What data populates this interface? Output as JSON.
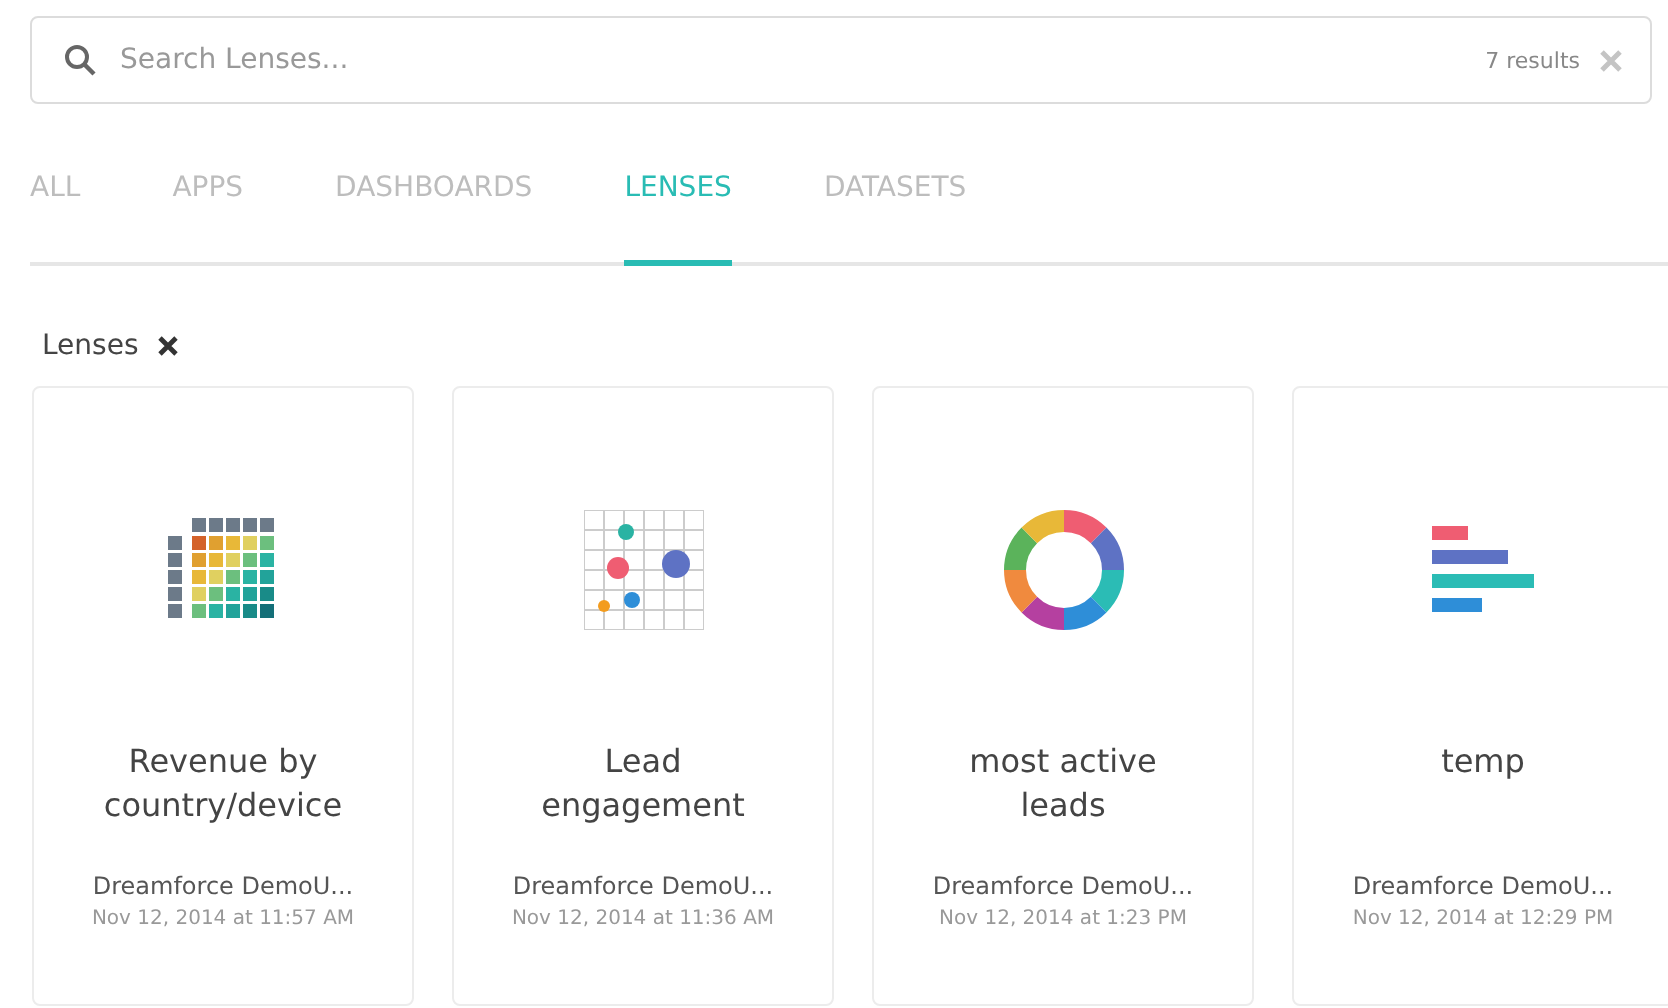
{
  "search": {
    "placeholder": "Search Lenses...",
    "results": "7 results"
  },
  "tabs": [
    {
      "label": "ALL",
      "selected": false
    },
    {
      "label": "APPS",
      "selected": false
    },
    {
      "label": "DASHBOARDS",
      "selected": false
    },
    {
      "label": "LENSES",
      "selected": true
    },
    {
      "label": "DATASETS",
      "selected": false
    }
  ],
  "filter": {
    "label": "Lenses"
  },
  "cards": [
    {
      "kind": "heatmap",
      "title": "Revenue by country/device",
      "owner": "Dreamforce DemoU...",
      "date": "Nov 12, 2014 at 11:57 AM"
    },
    {
      "kind": "scatter",
      "title": "Lead engagement",
      "owner": "Dreamforce DemoU...",
      "date": "Nov 12, 2014 at 11:36 AM"
    },
    {
      "kind": "donut",
      "title": "most active leads",
      "owner": "Dreamforce DemoU...",
      "date": "Nov 12, 2014 at 1:23 PM"
    },
    {
      "kind": "bar",
      "title": "temp",
      "owner": "Dreamforce DemoU...",
      "date": "Nov 12, 2014 at 12:29 PM"
    }
  ]
}
